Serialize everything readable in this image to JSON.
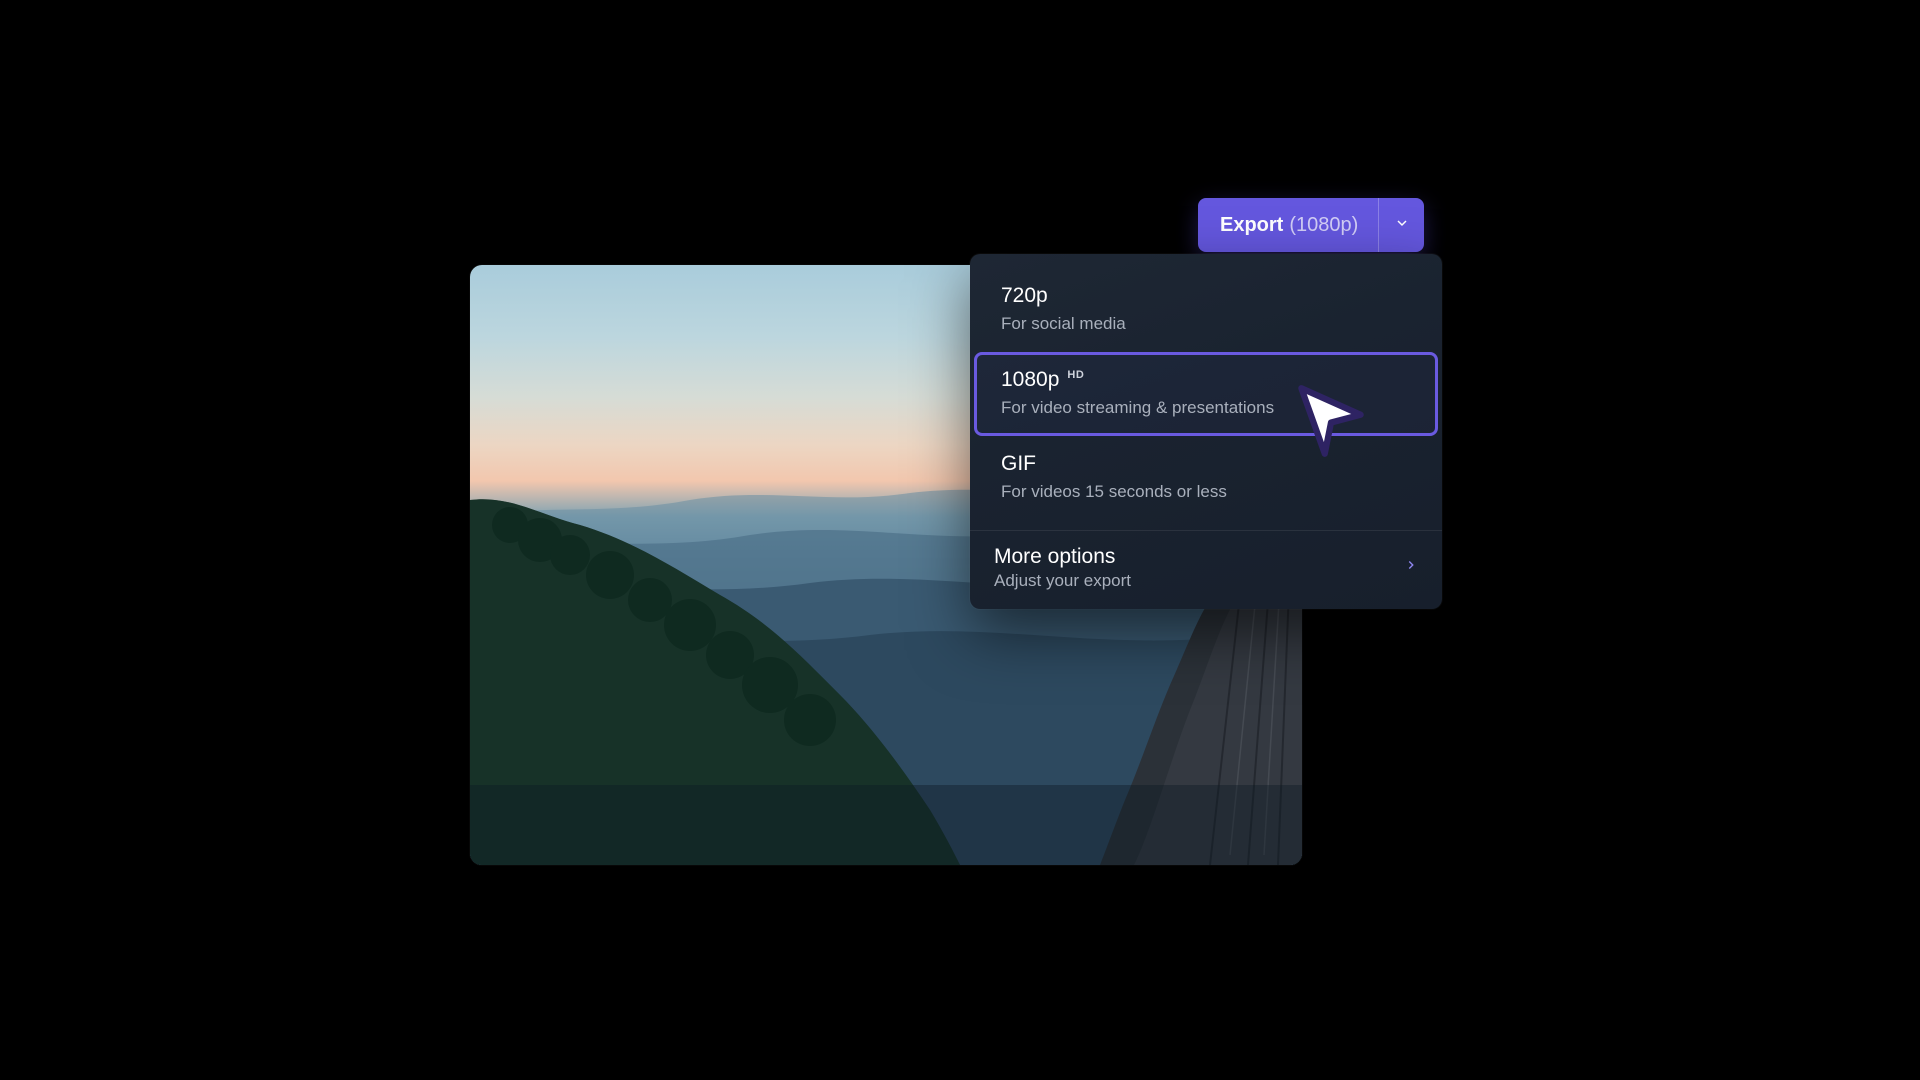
{
  "colors": {
    "accent": "#6457de",
    "accent_border": "#6a5ae0",
    "panel_bg": "#1b2431",
    "text_primary": "#ffffff",
    "text_secondary": "#a9b0bc"
  },
  "export_button": {
    "label": "Export",
    "resolution": "(1080p)"
  },
  "dropdown": {
    "options": [
      {
        "title": "720p",
        "badge": "",
        "subtitle": "For social media",
        "selected": false
      },
      {
        "title": "1080p",
        "badge": "HD",
        "subtitle": "For video streaming & presentations",
        "selected": true
      },
      {
        "title": "GIF",
        "badge": "",
        "subtitle": "For videos 15 seconds or less",
        "selected": false
      }
    ],
    "more": {
      "title": "More options",
      "subtitle": "Adjust your export"
    }
  }
}
